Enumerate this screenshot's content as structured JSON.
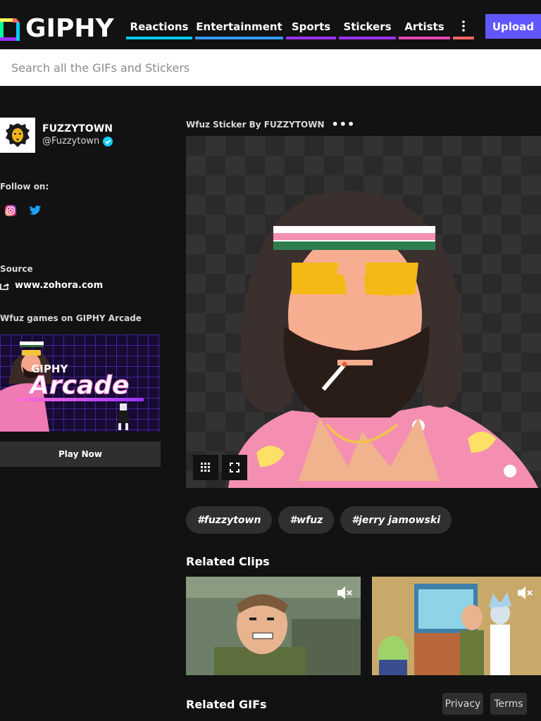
{
  "header": {
    "logo_text": "GIPHY",
    "nav": [
      {
        "label": "Reactions",
        "color": "#00ccff"
      },
      {
        "label": "Entertainment",
        "color": "#3399ff"
      },
      {
        "label": "Sports",
        "color": "#9933ff"
      },
      {
        "label": "Stickers",
        "color": "#9933ff"
      },
      {
        "label": "Artists",
        "color": "#e646b6"
      },
      {
        "label": "more",
        "color": "#ff6666"
      }
    ],
    "upload_label": "Upload",
    "upload_color": "#6157ff"
  },
  "search": {
    "placeholder": "Search all the GIFs and Stickers"
  },
  "sidebar": {
    "channel_name": "FUZZYTOWN",
    "channel_handle": "@Fuzzytown",
    "follow_label": "Follow on:",
    "social_icons": [
      "instagram-icon",
      "twitter-icon"
    ],
    "source_label": "Source",
    "source_link": "www.zohora.com",
    "arcade_label": "Wfuz games on GIPHY Arcade",
    "arcade_banner_text_top": "GIPHY",
    "arcade_banner_text_main": "Arcade",
    "play_now_label": "Play Now"
  },
  "main": {
    "gif_title": "Wfuz Sticker By FUZZYTOWN",
    "more_options": "•••",
    "tags": [
      "#fuzzytown",
      "#wfuz",
      "#jerry jamowski"
    ],
    "related_clips_heading": "Related Clips",
    "related_gifs_heading": "Related GIFs"
  },
  "footer": {
    "privacy_label": "Privacy",
    "terms_label": "Terms"
  }
}
